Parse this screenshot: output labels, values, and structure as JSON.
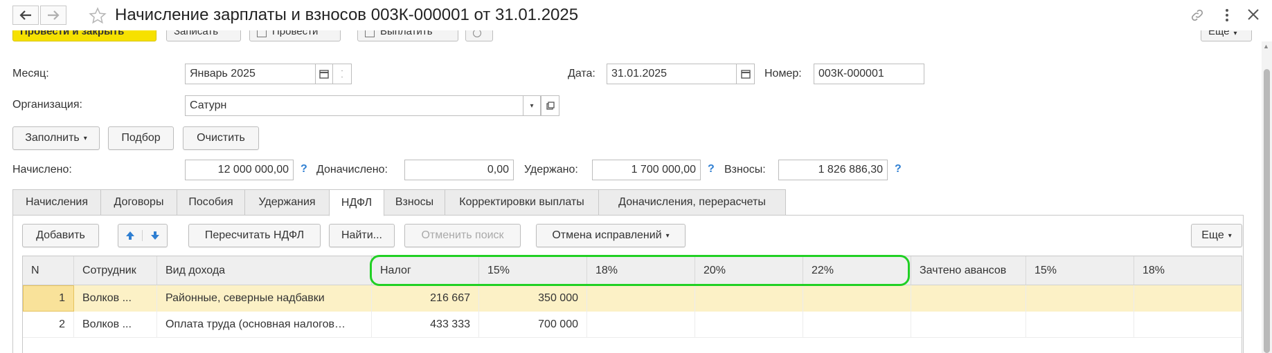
{
  "window": {
    "title": "Начисление зарплаты и взносов 003К-000001 от 31.01.2025"
  },
  "toolbar": {
    "post_close_label": "Провести и закрыть",
    "save_label": "Записать",
    "post_label": "Провести",
    "pay_label": "Выплатить",
    "more_label": "Еще"
  },
  "form": {
    "month_label": "Месяц:",
    "month_value": "Январь 2025",
    "date_label": "Дата:",
    "date_value": "31.01.2025",
    "number_label": "Номер:",
    "number_value": "003К-000001",
    "org_label": "Организация:",
    "org_value": "Сатурн"
  },
  "actions": {
    "fill_label": "Заполнить",
    "pick_label": "Подбор",
    "clear_label": "Очистить"
  },
  "totals": {
    "accrued_label": "Начислено:",
    "accrued_value": "12 000 000,00",
    "extra_label": "Доначислено:",
    "extra_value": "0,00",
    "withheld_label": "Удержано:",
    "withheld_value": "1 700 000,00",
    "contrib_label": "Взносы:",
    "contrib_value": "1 826 886,30",
    "help": "?"
  },
  "tabs": [
    {
      "label": "Начисления"
    },
    {
      "label": "Договоры"
    },
    {
      "label": "Пособия"
    },
    {
      "label": "Удержания"
    },
    {
      "label": "НДФЛ"
    },
    {
      "label": "Взносы"
    },
    {
      "label": "Корректировки выплаты"
    },
    {
      "label": "Доначисления, перерасчеты"
    }
  ],
  "panel_toolbar": {
    "add_label": "Добавить",
    "recalc_label": "Пересчитать НДФЛ",
    "find_label": "Найти...",
    "cancel_search_label": "Отменить поиск",
    "cancel_fix_label": "Отмена исправлений",
    "more_label": "Еще"
  },
  "grid": {
    "columns": [
      "N",
      "Сотрудник",
      "Вид дохода",
      "Налог",
      "15%",
      "18%",
      "20%",
      "22%",
      "Зачтено авансов",
      "15%",
      "18%"
    ],
    "rows": [
      {
        "n": "1",
        "employee": "Волков ...",
        "income": "Районные, северные надбавки",
        "tax": "216 667",
        "p15": "350 000",
        "p18": "",
        "p20": "",
        "p22": "",
        "adv": "",
        "a15": "",
        "a18": ""
      },
      {
        "n": "2",
        "employee": "Волков ...",
        "income": "Оплата труда (основная налогов…",
        "tax": "433 333",
        "p15": "700 000",
        "p18": "",
        "p20": "",
        "p22": "",
        "adv": "",
        "a15": "",
        "a18": ""
      }
    ]
  },
  "colors": {
    "accent_yellow": "#f6e100",
    "highlight_green": "#21d024",
    "selected_row": "#fcf1c6",
    "selected_cell": "#f9e29a",
    "help_blue": "#2f7fd2",
    "arrow_blue": "#2f7fd2"
  }
}
